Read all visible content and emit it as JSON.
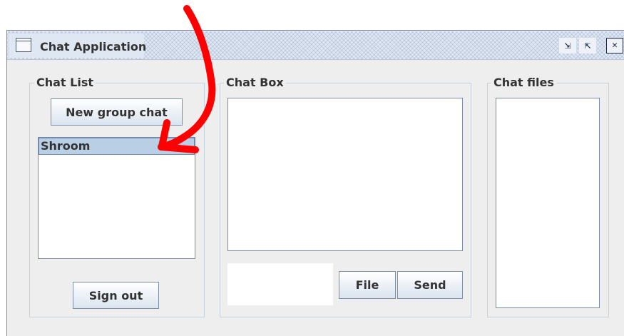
{
  "window": {
    "title": "Chat Application",
    "controls": {
      "minimize": "⇲",
      "maximize": "⇱",
      "close": "✕"
    }
  },
  "chat_list": {
    "legend": "Chat List",
    "new_group_label": "New group chat",
    "items": [
      {
        "label": "Shroom",
        "selected": true
      }
    ],
    "sign_out_label": "Sign out"
  },
  "chat_box": {
    "legend": "Chat Box",
    "message_value": "",
    "file_label": "File",
    "send_label": "Send"
  },
  "chat_files": {
    "legend": "Chat files"
  },
  "colors": {
    "window_bg": "#eeeeee",
    "selection": "#b8cfe5",
    "annotation_arrow": "#ff0000"
  }
}
